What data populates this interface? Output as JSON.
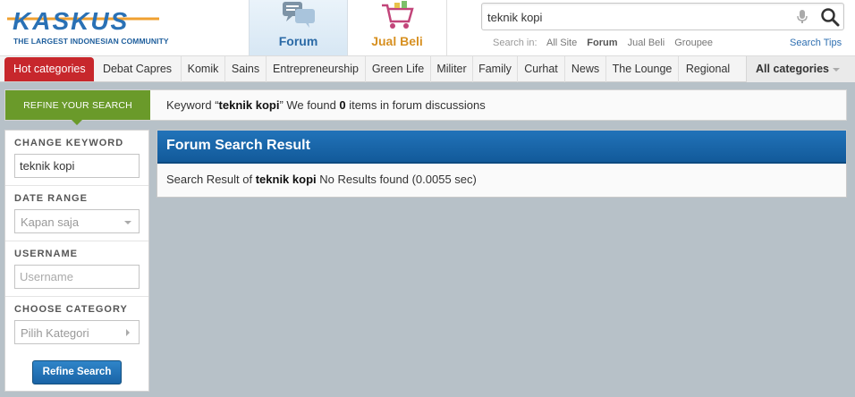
{
  "header": {
    "logo_text": "KASKUS",
    "logo_tagline": "THE LARGEST INDONESIAN COMMUNITY",
    "tabs": [
      {
        "label": "Forum",
        "active": true
      },
      {
        "label": "Jual Beli",
        "active": false
      }
    ],
    "search": {
      "value": "teknik kopi",
      "search_in_label": "Search in:",
      "options": [
        "All Site",
        "Forum",
        "Jual Beli",
        "Groupee"
      ],
      "active_option": "Forum",
      "tips": "Search Tips"
    }
  },
  "categories": {
    "hot": "Hot categories",
    "items": [
      "Debat Capres",
      "Komik",
      "Sains",
      "Entrepreneurship",
      "Green Life",
      "Militer",
      "Family",
      "Curhat",
      "News",
      "The Lounge",
      "Regional"
    ],
    "all": "All categories"
  },
  "refine": {
    "button": "REFINE YOUR SEARCH",
    "msg_prefix": "Keyword “",
    "keyword": "teknik kopi",
    "msg_mid": "” We found ",
    "count": "0",
    "msg_suffix": " items in forum discussions"
  },
  "sidebar": {
    "change_keyword": {
      "title": "CHANGE KEYWORD",
      "value": "teknik kopi"
    },
    "date_range": {
      "title": "DATE RANGE",
      "value": "Kapan saja"
    },
    "username": {
      "title": "USERNAME",
      "placeholder": "Username"
    },
    "category": {
      "title": "CHOOSE CATEGORY",
      "value": "Pilih Kategori"
    },
    "submit": "Refine Search"
  },
  "result": {
    "title": "Forum Search Result",
    "prefix": "Search Result of ",
    "keyword": "teknik kopi",
    "suffix": " No Results found (0.0055 sec)"
  },
  "colors": {
    "brand_blue": "#2273b9",
    "hot_red": "#c7272c",
    "refine_green": "#6a9a2a",
    "jualbeli_orange": "#d79021",
    "background": "#b7c1c8"
  }
}
